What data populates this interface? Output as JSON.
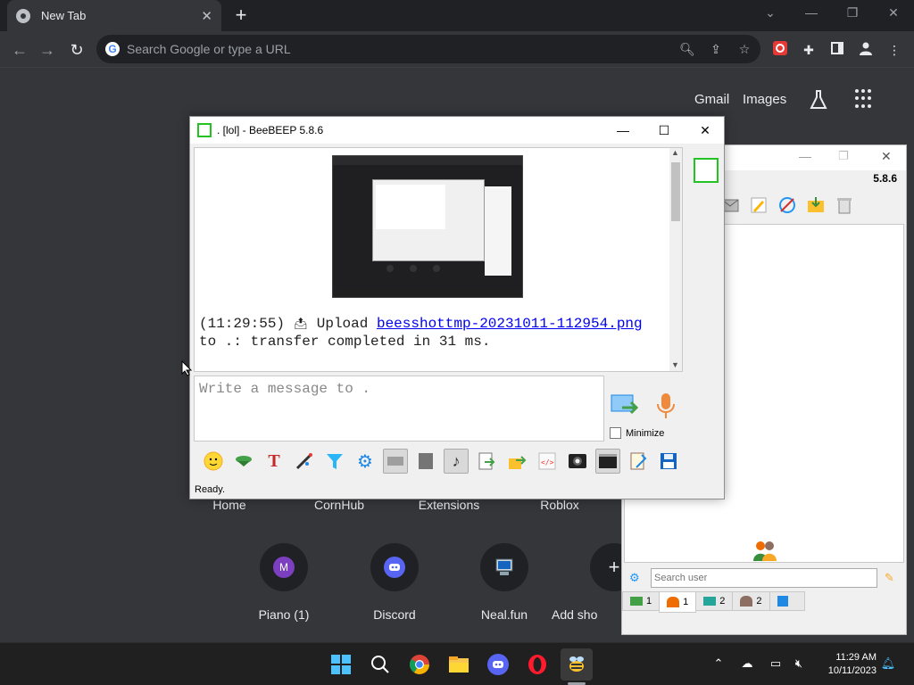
{
  "browser": {
    "tab_title": "New Tab",
    "tab_close": "✕",
    "new_tab": "+",
    "search_placeholder": "Search Google or type a URL",
    "gmail": "Gmail",
    "images": "Images"
  },
  "shortcuts_top": [
    "Home",
    "CornHub",
    "Extensions",
    "Roblox"
  ],
  "shortcuts_bottom": [
    {
      "label": "Piano (1)",
      "initial": "M"
    },
    {
      "label": "Discord"
    },
    {
      "label": "Neal.fun"
    },
    {
      "label": "Add sho"
    }
  ],
  "chat_window": {
    "title": ". [lol] - BeeBEEP 5.8.6",
    "message_time": "(11:29:55)",
    "message_upload": "Upload",
    "message_file": "beesshottmp-20231011-112954.png",
    "message_tail": "to .: transfer completed in 31 ms.",
    "composer_placeholder": "Write a message to .",
    "minimize_label": "Minimize",
    "status": "Ready."
  },
  "bg_window": {
    "version": "5.8.6",
    "search_placeholder": "Search user",
    "tabs": [
      {
        "icon": "chat-icon",
        "count": "1"
      },
      {
        "icon": "users-icon",
        "count": "1"
      },
      {
        "icon": "chat-group-icon",
        "count": "2"
      },
      {
        "icon": "group-icon",
        "count": "2"
      },
      {
        "icon": "share-icon",
        "count": ""
      }
    ]
  },
  "taskbar": {
    "time": "11:29 AM",
    "date": "10/11/2023"
  },
  "colors": {
    "chrome_dark": "#202124",
    "ntp_bg": "#35363a",
    "beebeep_green": "#22c322",
    "link": "#0000ee"
  }
}
